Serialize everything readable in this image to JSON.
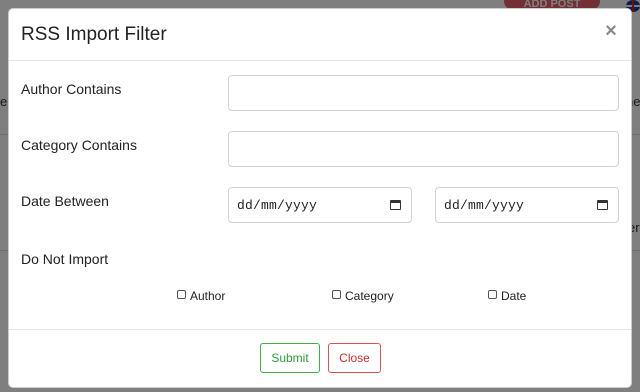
{
  "background": {
    "add_post_label": "ADD POST",
    "left_edge_fragments": [
      "eb"
    ],
    "right_edge_fragments": [
      "ne",
      "er"
    ]
  },
  "modal": {
    "title": "RSS Import Filter",
    "close_glyph": "×",
    "fields": {
      "author_label": "Author Contains",
      "author_value": "",
      "category_label": "Category Contains",
      "category_value": "",
      "date_label": "Date Between",
      "date_from_placeholder": "dd/mm/yyyy",
      "date_to_placeholder": "dd/mm/yyyy"
    },
    "do_not_import": {
      "label": "Do Not Import",
      "options": [
        {
          "label": "Author",
          "checked": false
        },
        {
          "label": "Category",
          "checked": false
        },
        {
          "label": "Date",
          "checked": false
        }
      ]
    },
    "footer": {
      "submit_label": "Submit",
      "close_label": "Close"
    }
  },
  "colors": {
    "submit_green": "#3fae49",
    "close_red": "#d9534f",
    "add_post_red": "#e4606d"
  },
  "icons": [
    "close-icon",
    "calendar-icon",
    "flag-uk-icon"
  ]
}
